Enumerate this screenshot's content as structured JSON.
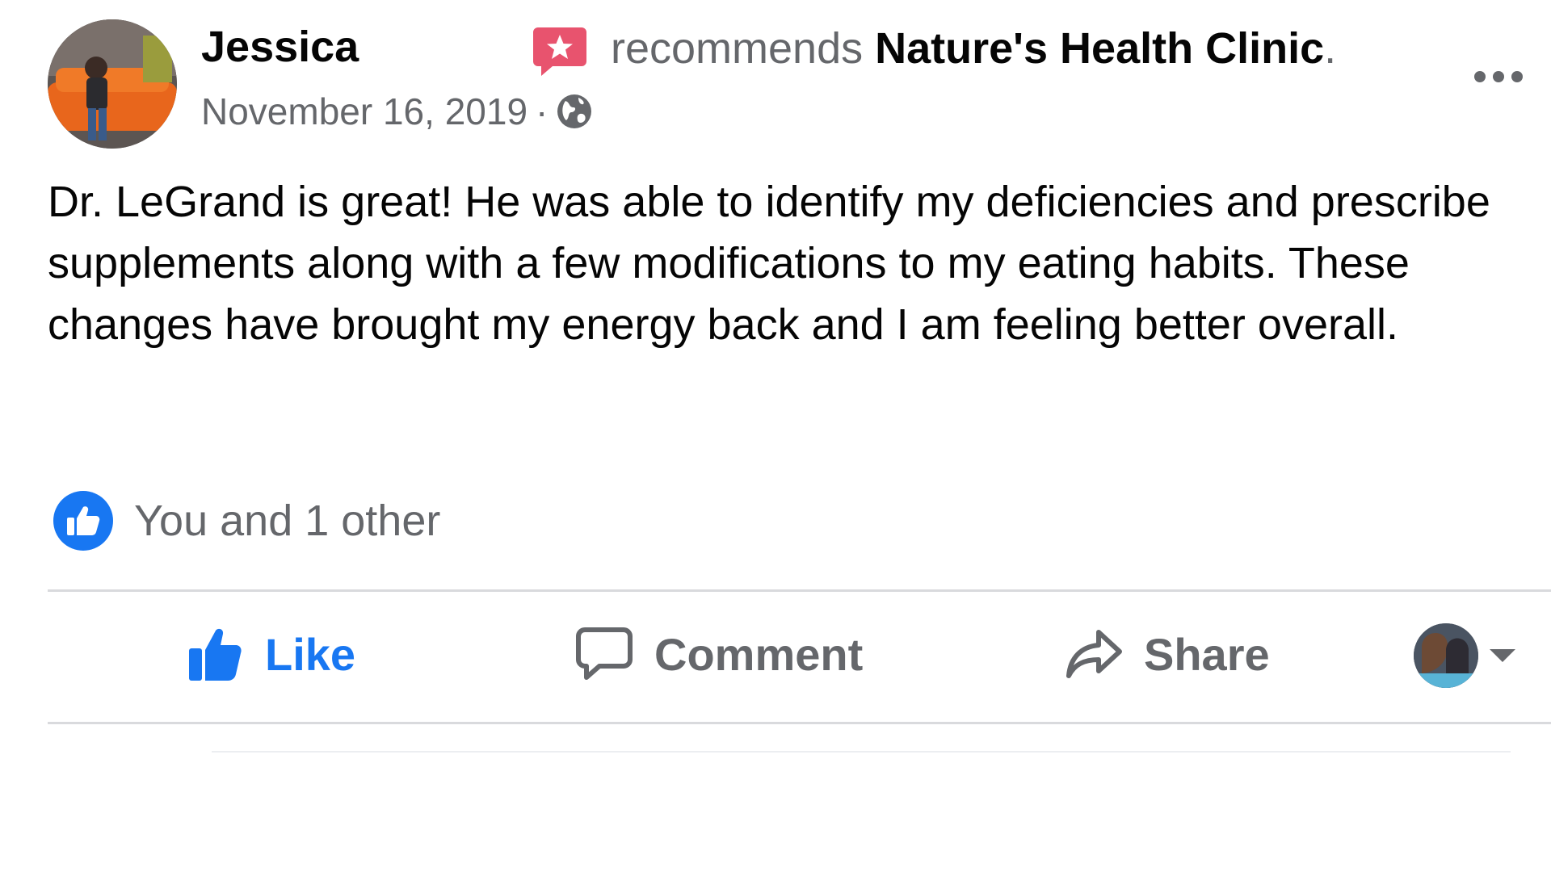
{
  "post": {
    "author": "Jessica",
    "action_word": "recommends",
    "page_name": "Nature's Health Clinic",
    "page_name_suffix": ".",
    "date": "November 16, 2019",
    "separator": "·",
    "privacy_icon": "globe-icon",
    "more_icon": "more-options-icon",
    "text": "Dr. LeGrand is great! He was able to identify my deficiencies and prescribe supplements along with a few modifications to my eating habits. These changes have brought my energy back and I am feeling better overall."
  },
  "reactions": {
    "icon": "like-reaction-icon",
    "summary": "You and 1 other"
  },
  "actions": {
    "like_label": "Like",
    "comment_label": "Comment",
    "share_label": "Share"
  },
  "colors": {
    "brand_blue": "#1877f2",
    "secondary_text": "#65676b",
    "recommend_badge": "#e8536e",
    "divider": "#d9dadd"
  }
}
